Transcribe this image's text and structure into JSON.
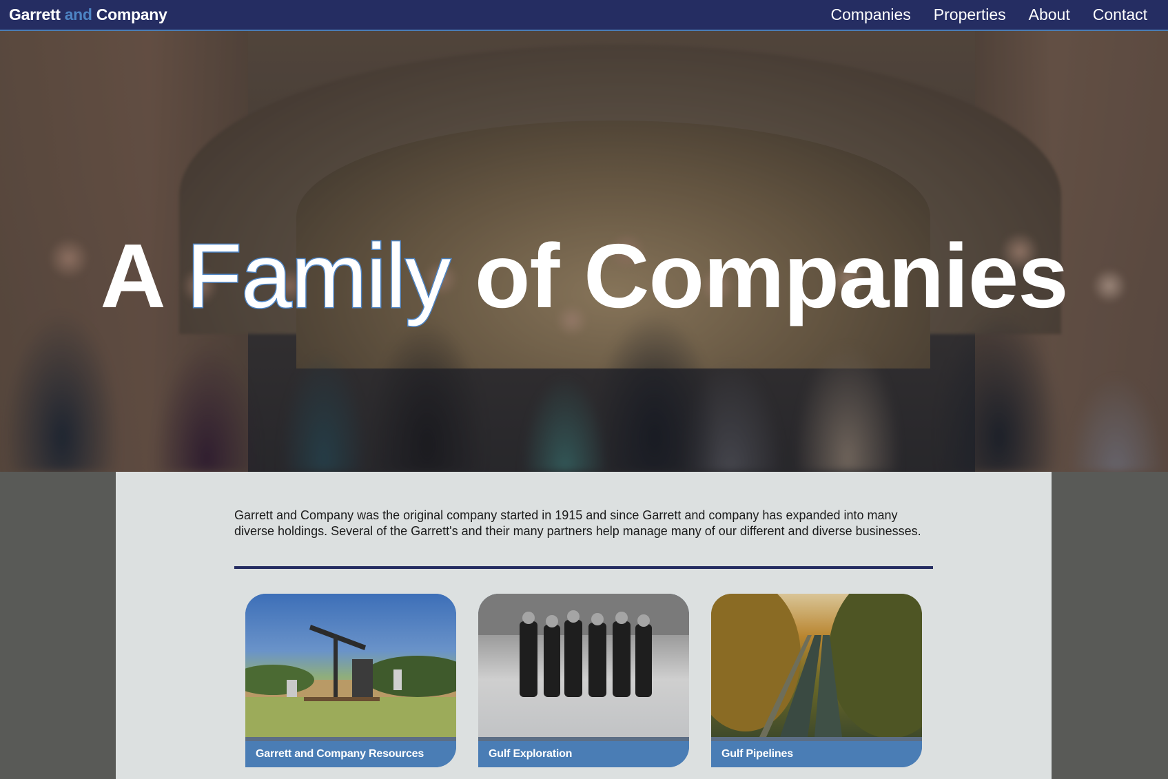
{
  "navbar": {
    "brand_part1": "Garrett",
    "brand_part2": "and",
    "brand_part3": "Company",
    "links": [
      "Companies",
      "Properties",
      "About",
      "Contact"
    ]
  },
  "hero": {
    "word1": "A",
    "word2": "Family",
    "word3": "of Companies"
  },
  "intro": {
    "text": "Garrett and Company was the original company started in 1915 and since Garrett and company has expanded into many diverse holdings. Several of the Garrett's and their many partners help manage many of our different and diverse businesses."
  },
  "cards": [
    {
      "label": "Garrett and Company Resources",
      "icon": "oil-pumpjack-photo"
    },
    {
      "label": "Gulf Exploration",
      "icon": "historic-group-photo"
    },
    {
      "label": "Gulf Pipelines",
      "icon": "pipeline-forest-photo"
    }
  ],
  "colors": {
    "nav_bg": "#252d62",
    "accent": "#4a7db5",
    "content_bg": "#dce0e0",
    "page_bg": "#595a57"
  }
}
